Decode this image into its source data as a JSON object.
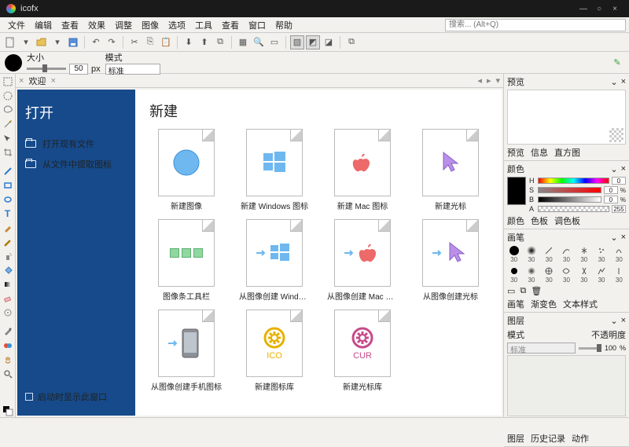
{
  "app": {
    "title": "icofx"
  },
  "window_buttons": {
    "min": "—",
    "max": "○",
    "close": "×"
  },
  "menu": [
    "文件",
    "编辑",
    "查看",
    "效果",
    "调整",
    "图像",
    "选项",
    "工具",
    "查看",
    "窗口",
    "帮助"
  ],
  "search": {
    "placeholder": "搜索... (Alt+Q)"
  },
  "toolbar2": {
    "size_label": "大小",
    "size_value": "50",
    "size_unit": "px",
    "mode_label": "模式",
    "mode_value": "标准"
  },
  "tabs": {
    "welcome": "欢迎"
  },
  "sidebar": {
    "title": "打开",
    "items": [
      {
        "label": "打开现有文件"
      },
      {
        "label": "从文件中提取图标"
      }
    ],
    "footer": "启动时显示此窗口"
  },
  "content": {
    "title": "新建",
    "cards": [
      {
        "label": "新建图像"
      },
      {
        "label": "新建 Windows 图标"
      },
      {
        "label": "新建 Mac 图标"
      },
      {
        "label": "新建光标"
      },
      {
        "label": "图像条工具栏"
      },
      {
        "label": "从图像创建 Windows ..."
      },
      {
        "label": "从图像创建 Mac 图标"
      },
      {
        "label": "从图像创建光标"
      },
      {
        "label": "从图像创建手机图标"
      },
      {
        "label": "新建图标库",
        "badge": "ICO"
      },
      {
        "label": "新建光标库",
        "badge": "CUR"
      }
    ]
  },
  "panels": {
    "preview": {
      "title": "预览",
      "tabs": [
        "预览",
        "信息",
        "直方图"
      ]
    },
    "color": {
      "title": "颜色",
      "H": "H",
      "S": "S",
      "B": "B",
      "A": "A",
      "v0": "0",
      "v255": "255",
      "pct": "%",
      "tabs": [
        "颜色",
        "色板",
        "调色板"
      ]
    },
    "brush": {
      "title": "画笔",
      "val30": "30",
      "tabs": [
        "画笔",
        "渐变色",
        "文本样式"
      ]
    },
    "layer": {
      "title": "图层",
      "mode_label": "模式",
      "mode_value": "标准",
      "opacity_label": "不透明度",
      "opacity_value": "100",
      "pct": "%",
      "tabs": [
        "图层",
        "历史记录",
        "动作"
      ]
    }
  }
}
